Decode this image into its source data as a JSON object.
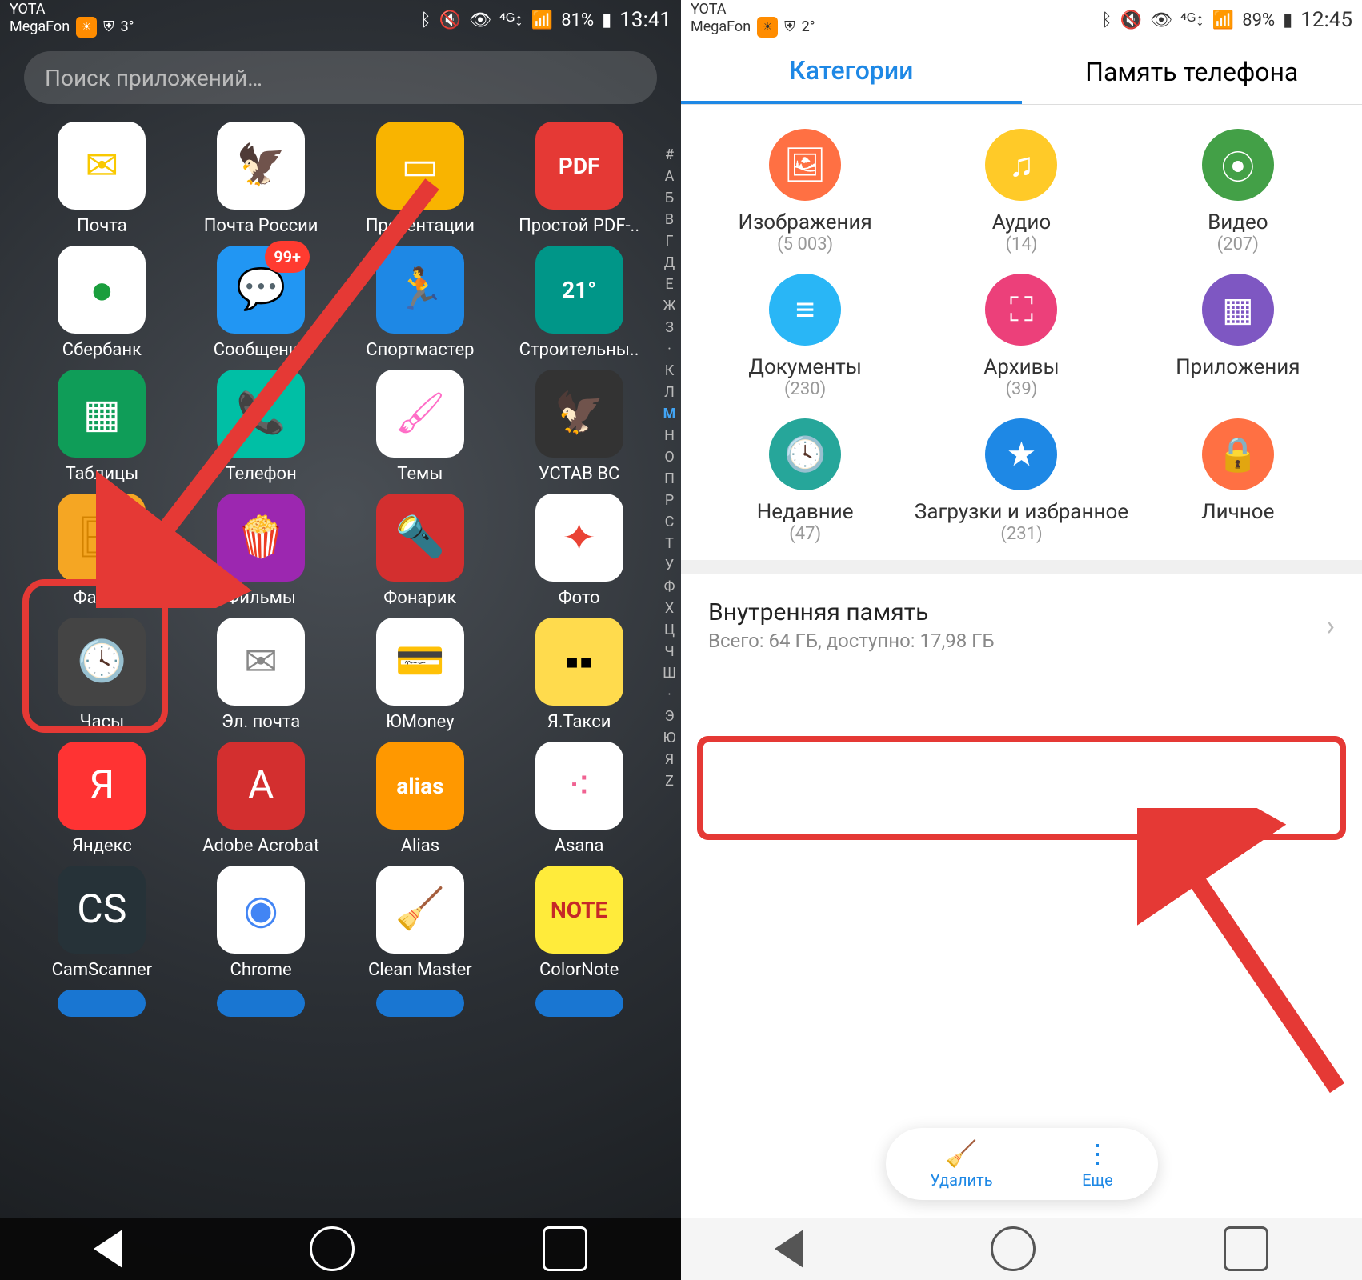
{
  "left": {
    "status": {
      "carrier1": "YOTA",
      "carrier2": "MegaFon",
      "temp": "3°",
      "battery": "81%",
      "time": "13:41"
    },
    "search_placeholder": "Поиск приложений…",
    "apps": [
      {
        "label": "Почта",
        "bg": "#ffffff",
        "fg": "#f9c900",
        "glyph": "✉"
      },
      {
        "label": "Почта России",
        "bg": "#ffffff",
        "fg": "#1e4fa3",
        "glyph": "🦅"
      },
      {
        "label": "Презентации",
        "bg": "#f9b400",
        "fg": "#fff",
        "glyph": "▭"
      },
      {
        "label": "Простой PDF-..",
        "bg": "#e53935",
        "fg": "#fff",
        "glyph": "PDF"
      },
      {
        "label": "Сбербанк",
        "bg": "#ffffff",
        "fg": "#1a9e3d",
        "glyph": "●"
      },
      {
        "label": "Сообщения",
        "bg": "#2196f3",
        "fg": "#fff",
        "glyph": "💬",
        "badge": "99+"
      },
      {
        "label": "Спортмастер",
        "bg": "#1e88e5",
        "fg": "#fff",
        "glyph": "🏃"
      },
      {
        "label": "Строительны..",
        "bg": "#009688",
        "fg": "#fff",
        "glyph": "21°"
      },
      {
        "label": "Таблицы",
        "bg": "#0f9d58",
        "fg": "#fff",
        "glyph": "▦"
      },
      {
        "label": "Телефон",
        "bg": "#00bfa5",
        "fg": "#fff",
        "glyph": "📞"
      },
      {
        "label": "Темы",
        "bg": "#ffffff",
        "fg": "#ff6ec7",
        "glyph": "🖌"
      },
      {
        "label": "УСТАВ ВС",
        "bg": "#333",
        "fg": "#ffd54f",
        "glyph": "🦅"
      },
      {
        "label": "Файлы",
        "bg": "#f5a623",
        "fg": "#d48300",
        "glyph": "🗄"
      },
      {
        "label": "Фильмы",
        "bg": "#9c27b0",
        "fg": "#ffd54f",
        "glyph": "🍿"
      },
      {
        "label": "Фонарик",
        "bg": "#d32f2f",
        "fg": "#fff",
        "glyph": "🔦"
      },
      {
        "label": "Фото",
        "bg": "#ffffff",
        "fg": "#ea4335",
        "glyph": "✦"
      },
      {
        "label": "Часы",
        "bg": "#444",
        "fg": "#ddd",
        "glyph": "🕓"
      },
      {
        "label": "Эл. почта",
        "bg": "#ffffff",
        "fg": "#888",
        "glyph": "✉"
      },
      {
        "label": "ЮMoney",
        "bg": "#ffffff",
        "fg": "#7b1fa2",
        "glyph": "💳"
      },
      {
        "label": "Я.Такси",
        "bg": "#ffdb4d",
        "fg": "#000",
        "glyph": "▪▪"
      },
      {
        "label": "Яндекс",
        "bg": "#ff3333",
        "fg": "#fff",
        "glyph": "Я"
      },
      {
        "label": "Adobe Acrobat",
        "bg": "#d32f2f",
        "fg": "#fff",
        "glyph": "A"
      },
      {
        "label": "Alias",
        "bg": "#ff9800",
        "fg": "#fff",
        "glyph": "alias"
      },
      {
        "label": "Asana",
        "bg": "#ffffff",
        "fg": "#f06292",
        "glyph": "⁖"
      },
      {
        "label": "CamScanner",
        "bg": "#263238",
        "fg": "#fff",
        "glyph": "CS"
      },
      {
        "label": "Chrome",
        "bg": "#ffffff",
        "fg": "#4285f4",
        "glyph": "◉"
      },
      {
        "label": "Clean Master",
        "bg": "#ffffff",
        "fg": "#795548",
        "glyph": "🧹"
      },
      {
        "label": "ColorNote",
        "bg": "#ffeb3b",
        "fg": "#c62828",
        "glyph": "NOTE"
      }
    ],
    "alpha": [
      "#",
      "А",
      "Б",
      "В",
      "Г",
      "Д",
      "Е",
      "Ж",
      "З",
      "·",
      "К",
      "Л",
      "М",
      "Н",
      "О",
      "П",
      "Р",
      "С",
      "Т",
      "У",
      "Ф",
      "Х",
      "Ц",
      "Ч",
      "Ш",
      "·",
      "Э",
      "Ю",
      "Я",
      "Z"
    ]
  },
  "right": {
    "status": {
      "carrier1": "YOTA",
      "carrier2": "MegaFon",
      "temp": "2°",
      "battery": "89%",
      "time": "12:45"
    },
    "tabs": {
      "active": "Категории",
      "other": "Память телефона"
    },
    "categories": [
      {
        "label": "Изображения",
        "count": "(5 003)",
        "bg": "#ff7043",
        "glyph": "🖼"
      },
      {
        "label": "Аудио",
        "count": "(14)",
        "bg": "#ffca28",
        "glyph": "♫"
      },
      {
        "label": "Видео",
        "count": "(207)",
        "bg": "#43a047",
        "glyph": "⦿"
      },
      {
        "label": "Документы",
        "count": "(230)",
        "bg": "#29b6f6",
        "glyph": "≡"
      },
      {
        "label": "Архивы",
        "count": "(39)",
        "bg": "#ec407a",
        "glyph": "⛶"
      },
      {
        "label": "Приложения",
        "count": "",
        "bg": "#7e57c2",
        "glyph": "▦"
      },
      {
        "label": "Недавние",
        "count": "(47)",
        "bg": "#26a69a",
        "glyph": "🕓"
      },
      {
        "label": "Загрузки и избранное",
        "count": "(231)",
        "bg": "#1e88e5",
        "glyph": "★"
      },
      {
        "label": "Личное",
        "count": "",
        "bg": "#ff7043",
        "glyph": "🔒"
      }
    ],
    "storage": {
      "title": "Внутренняя память",
      "sub": "Всего: 64 ГБ, доступно: 17,98 ГБ"
    },
    "pill": {
      "delete": "Удалить",
      "more": "Еще"
    }
  }
}
